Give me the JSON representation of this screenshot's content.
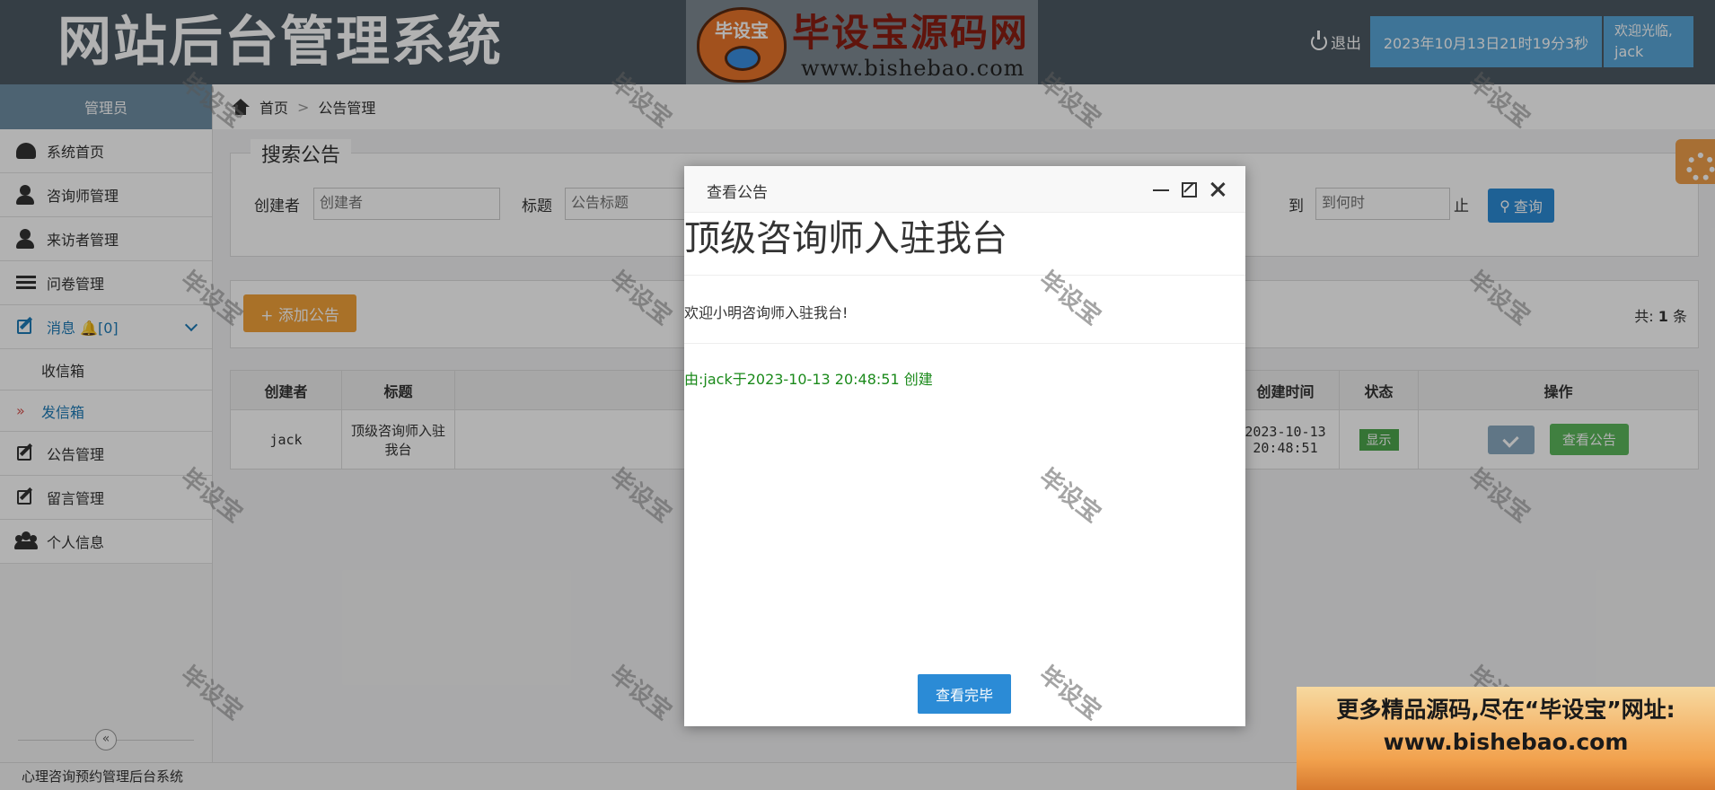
{
  "header": {
    "system_title": "网站后台管理系统",
    "logo_badge": "毕设宝",
    "logo_text": "毕设宝源码网",
    "logo_url": "www.bishebao.com",
    "logout": "退出",
    "datetime": "2023年10月13日21时19分3秒",
    "welcome_line1": "欢迎光临,",
    "welcome_user": "jack"
  },
  "sidebar": {
    "role": "管理员",
    "items": [
      {
        "label": "系统首页",
        "icon": "dashboard-icon"
      },
      {
        "label": "咨询师管理",
        "icon": "user-icon"
      },
      {
        "label": "来访者管理",
        "icon": "user-icon"
      },
      {
        "label": "问卷管理",
        "icon": "list-icon"
      },
      {
        "label": "消息 🔔[0]",
        "icon": "edit-icon"
      },
      {
        "label": "公告管理",
        "icon": "edit-icon"
      },
      {
        "label": "留言管理",
        "icon": "edit-icon"
      },
      {
        "label": "个人信息",
        "icon": "group-icon"
      }
    ],
    "sub_items": [
      {
        "label": "收信箱"
      },
      {
        "label": "发信箱",
        "bullet": "»"
      }
    ],
    "collapse": "«"
  },
  "breadcrumb": {
    "home": "首页",
    "separator": ">",
    "current": "公告管理"
  },
  "search": {
    "legend": "搜索公告",
    "creator_label": "创建者",
    "creator_placeholder": "创建者",
    "title_label": "标题",
    "title_placeholder": "公告标题",
    "to_label": "到",
    "to_placeholder": "到何时",
    "end_suffix": "止",
    "query_button": "查询"
  },
  "toolbar": {
    "add_button": "+ 添加公告",
    "total_prefix": "共:",
    "total_count": "1",
    "total_suffix": "条"
  },
  "table": {
    "headers": [
      "创建者",
      "标题",
      "",
      "创建时间",
      "状态",
      "操作"
    ],
    "rows": [
      {
        "creator": "jack",
        "title": "顶级咨询师入驻我台",
        "created": "2023-10-13 20:48:51",
        "status": "显示",
        "action": "查看公告"
      }
    ]
  },
  "modal": {
    "title": "查看公告",
    "notice_title": "顶级咨询师入驻我台",
    "notice_body": "欢迎小明咨询师入驻我台!",
    "notice_meta": "由:jack于2023-10-13 20:48:51 创建",
    "done_button": "查看完毕"
  },
  "footer": {
    "text": "心理咨询预约管理后台系统"
  },
  "watermark": "毕设宝",
  "ad": {
    "line1": "更多精品源码,尽在“毕设宝”网址:",
    "line2": "www.bishebao.com"
  },
  "colors": {
    "header_bg": "#4d5963",
    "accent_blue": "#2b8bd6",
    "datetime_bg": "#5aa7d8",
    "add_button": "#f3a23a",
    "status_green": "#4ca64c"
  }
}
